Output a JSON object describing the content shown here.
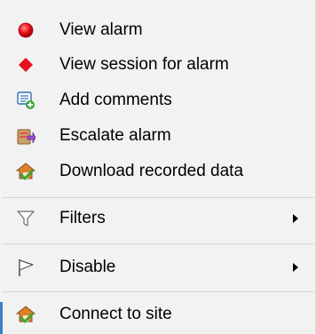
{
  "menu": {
    "items": [
      {
        "label": "View alarm",
        "icon": "red-circle-alarm-icon"
      },
      {
        "label": "View session for alarm",
        "icon": "red-diamond-icon"
      },
      {
        "label": "Add comments",
        "icon": "add-comment-icon"
      },
      {
        "label": "Escalate alarm",
        "icon": "escalate-alarm-icon"
      },
      {
        "label": "Download recorded data",
        "icon": "download-house-icon"
      },
      {
        "label": "Filters",
        "icon": "funnel-filter-icon",
        "has_submenu": true
      },
      {
        "label": "Disable",
        "icon": "flag-disable-icon",
        "has_submenu": true
      },
      {
        "label": "Connect to site",
        "icon": "connect-house-icon"
      }
    ]
  },
  "colors": {
    "menu_background": "#f2f2f2",
    "separator": "#d6d6d6",
    "alarm_red": "#e8101a",
    "diamond_red": "#e81020",
    "house_orange": "#d9822b",
    "check_green": "#3aa53a"
  }
}
